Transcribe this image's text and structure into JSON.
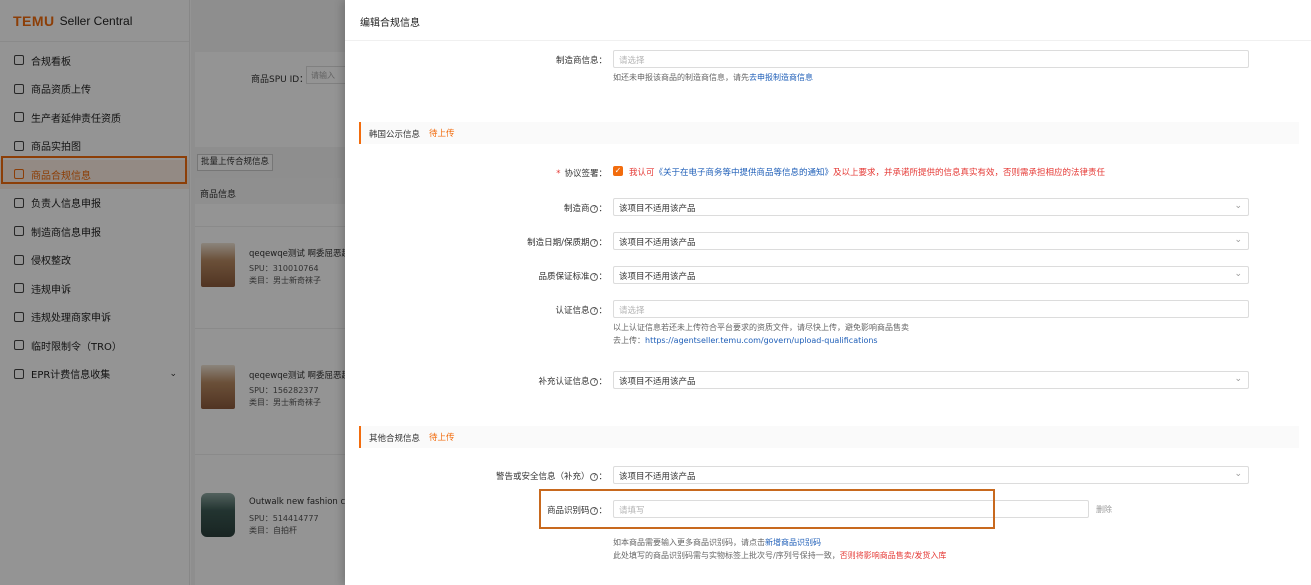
{
  "app": {
    "logo": "TEMU",
    "logo_sub": "Seller Central"
  },
  "sidebar": {
    "items": [
      {
        "label": "合规看板",
        "icon": "dashboard-icon"
      },
      {
        "label": "商品资质上传",
        "icon": "upload-icon"
      },
      {
        "label": "生产者延伸责任资质",
        "icon": "certificate-icon"
      },
      {
        "label": "商品实拍图",
        "icon": "image-icon"
      },
      {
        "label": "商品合规信息",
        "icon": "compliance-icon",
        "active": true
      },
      {
        "label": "负责人信息申报",
        "icon": "person-icon"
      },
      {
        "label": "制造商信息申报",
        "icon": "factory-icon"
      },
      {
        "label": "侵权整改",
        "icon": "warning-icon"
      },
      {
        "label": "违规申诉",
        "icon": "appeal-icon"
      },
      {
        "label": "违规处理商家申诉",
        "icon": "appeal-merchant-icon"
      },
      {
        "label": "临时限制令（TRO）",
        "icon": "restriction-icon"
      },
      {
        "label": "EPR计费信息收集",
        "icon": "epr-icon"
      }
    ]
  },
  "content": {
    "filter_label": "商品SPU ID：",
    "filter_placeholder": "请输入",
    "batch_button": "批量上传合规信息",
    "list_header": "商品信息",
    "products": [
      {
        "name": "qeqewqe测试 啊委屈恶趣",
        "spu": "SPU：310010764",
        "category": "类目：男士新奇袜子"
      },
      {
        "name": "qeqewqe测试 啊委屈恶趣",
        "spu": "SPU：156282377",
        "category": "类目：男士新奇袜子"
      },
      {
        "name": "Outwalk new fashion cas",
        "spu": "SPU：514414777",
        "category": "类目：自拍杆"
      }
    ]
  },
  "drawer": {
    "title": "编辑合规信息",
    "manufacturer": {
      "label": "制造商信息：",
      "placeholder": "请选择",
      "hint_prefix": "如还未申报该商品的制造商信息，请先",
      "hint_link": "去申报制造商信息"
    },
    "korea_section": {
      "title": "韩国公示信息",
      "status": "待上传",
      "agreement_label": "协议签署：",
      "agreement_text_prefix": "我认可",
      "agreement_link": "《关于在电子商务等中提供商品等信息的通知》",
      "agreement_text_suffix": "及以上要求，并承诺所提供的信息真实有效，否则需承担相应的法律责任",
      "fields": [
        {
          "label": "制造商",
          "value": "该项目不适用该产品"
        },
        {
          "label": "制造日期/保质期",
          "value": "该项目不适用该产品"
        },
        {
          "label": "品质保证标准",
          "value": "该项目不适用该产品"
        }
      ],
      "cert_label": "认证信息",
      "cert_placeholder": "请选择",
      "cert_hint_line1": "以上认证信息若还未上传符合平台要求的资质文件，请尽快上传，避免影响商品售卖",
      "cert_hint_line2_prefix": "去上传：",
      "cert_hint_link": "https://agentseller.temu.com/govern/upload-qualifications",
      "supp_cert_label": "补充认证信息",
      "supp_cert_value": "该项目不适用该产品"
    },
    "other_section": {
      "title": "其他合规信息",
      "status": "待上传",
      "warning_label": "警告或安全信息（补充）",
      "warning_value": "该项目不适用该产品",
      "code_label": "商品识别码",
      "code_placeholder": "请填写",
      "delete_label": "删除",
      "code_hint_prefix": "如本商品需要输入更多商品识别码，请点击",
      "code_hint_link": "新增商品识别码",
      "code_hint2_prefix": "此处填写的商品识别码需与实物标签上批次号/序列号保持一致，",
      "code_hint2_red": "否则将影响商品售卖/发货入库"
    }
  },
  "colors": {
    "accent": "#f26c0d",
    "link": "#1f5fb8",
    "error": "#e53935"
  }
}
